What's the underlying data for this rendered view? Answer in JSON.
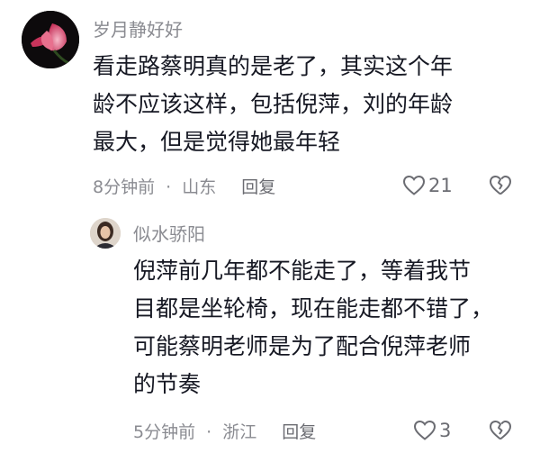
{
  "comments": [
    {
      "username": "岁月静好好",
      "lines": [
        "看走路蔡明真的是老了，其实这个年",
        "龄不应该这样，包括倪萍，刘的年龄",
        "最大，但是觉得她最年轻"
      ],
      "time": "8分钟前",
      "separator": "·",
      "location": "山东",
      "reply_label": "回复",
      "likes": "21",
      "avatar_icon": "lotus-flower-avatar"
    },
    {
      "username": "似水骄阳",
      "lines": [
        "倪萍前几年都不能走了，等着我节",
        "目都是坐轮椅，现在能走都不错了，",
        "可能蔡明老师是为了配合倪萍老师",
        "的节奏"
      ],
      "time": "5分钟前",
      "separator": "·",
      "location": "浙江",
      "reply_label": "回复",
      "likes": "3",
      "avatar_icon": "woman-portrait-avatar"
    }
  ],
  "colors": {
    "text_primary": "#161823",
    "text_secondary": "#8a8b91",
    "icon": "#6b6c72"
  }
}
